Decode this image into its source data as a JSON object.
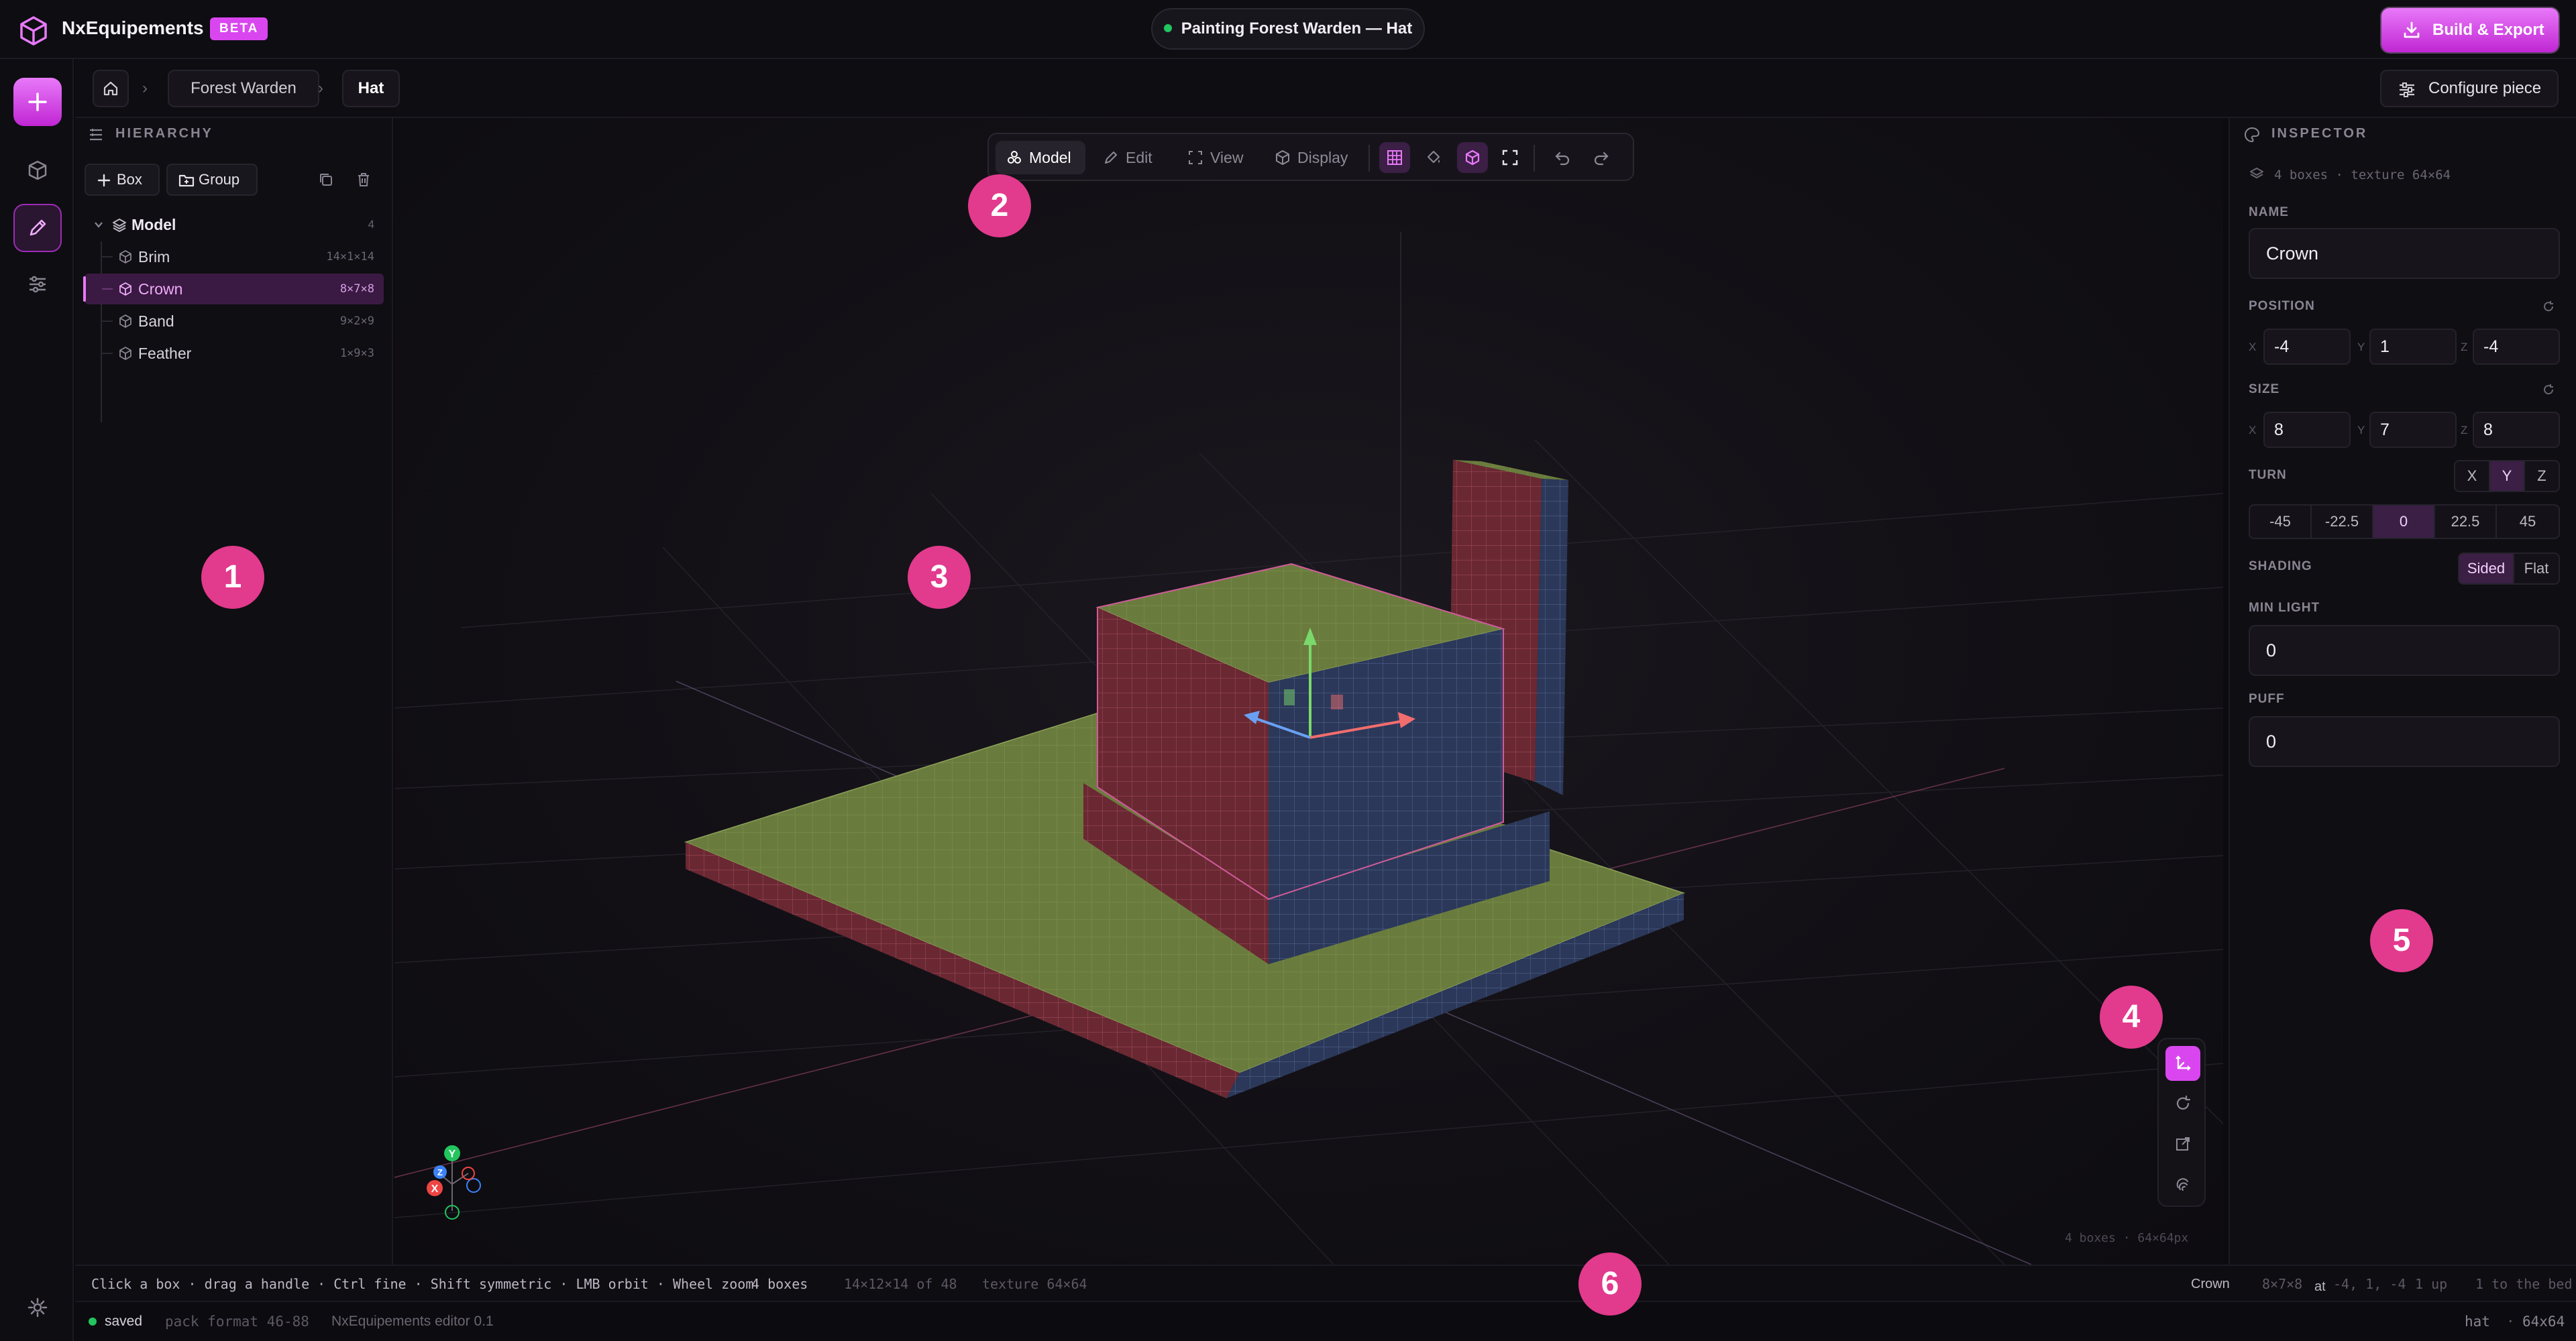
{
  "app": {
    "name": "NxEquipements",
    "badge": "BETA"
  },
  "status_pill": "Painting Forest Warden — Hat",
  "export_label": "Build & Export",
  "breadcrumb": {
    "items": [
      "Forest Warden",
      "Hat"
    ],
    "separator": "›"
  },
  "configure_label": "Configure piece",
  "hierarchy": {
    "title": "HIERARCHY",
    "add_box": "Box",
    "add_group": "Group",
    "root": {
      "label": "Model",
      "count": "4"
    },
    "items": [
      {
        "label": "Brim",
        "size": "14×1×14",
        "selected": false
      },
      {
        "label": "Crown",
        "size": "8×7×8",
        "selected": true
      },
      {
        "label": "Band",
        "size": "9×2×9",
        "selected": false
      },
      {
        "label": "Feather",
        "size": "1×9×3",
        "selected": false
      }
    ]
  },
  "viewport": {
    "tabs": [
      {
        "label": "Model",
        "active": true
      },
      {
        "label": "Edit",
        "active": false
      },
      {
        "label": "View",
        "active": false
      },
      {
        "label": "Display",
        "active": false
      }
    ],
    "corner_stat": "4 boxes · 64×64px",
    "gizmo_axes": [
      "Y",
      "X",
      "Z"
    ]
  },
  "inspector": {
    "title": "INSPECTOR",
    "subtitle": "4 boxes · texture 64×64",
    "name_label": "NAME",
    "name_value": "Crown",
    "position_label": "POSITION",
    "position": {
      "x": "-4",
      "y": "1",
      "z": "-4"
    },
    "size_label": "SIZE",
    "size": {
      "x": "8",
      "y": "7",
      "z": "8"
    },
    "axis_labels": {
      "x": "X",
      "y": "Y",
      "z": "Z"
    },
    "turn_label": "TURN",
    "turn_axes": [
      "X",
      "Y",
      "Z"
    ],
    "turn_axis_selected": "Y",
    "turn_values": [
      "-45",
      "-22.5",
      "0",
      "22.5",
      "45"
    ],
    "turn_selected": "0",
    "shading_label": "SHADING",
    "shading_options": [
      "Sided",
      "Flat"
    ],
    "shading_selected": "Sided",
    "min_light_label": "MIN LIGHT",
    "min_light_value": "0",
    "puff_label": "PUFF",
    "puff_value": "0"
  },
  "hint_bar": {
    "hints": "Click a box · drag a handle · Ctrl fine · Shift symmetric · LMB orbit · Wheel zoom",
    "boxes": "4 boxes",
    "area": "14×12×14 of 48",
    "texture": "texture 64×64",
    "sel_name": "Crown",
    "sel_size": "8×7×8",
    "sel_at_word": "at",
    "sel_pos": "-4, 1, -4",
    "sel_up": "1 up",
    "sel_bed": "1 to the bed"
  },
  "status_bar": {
    "saved": "saved",
    "format": "pack format 46-88",
    "version": "NxEquipements editor 0.1",
    "piece": "hat",
    "texture": "64x64"
  },
  "markers": [
    "1",
    "2",
    "3",
    "4",
    "5",
    "6"
  ],
  "colors": {
    "accent": "#d946ef",
    "marker": "#e23a8d",
    "saved": "#22c55e",
    "top_face": "#6b7d3f",
    "side_red": "#6e2a34",
    "side_blue": "#2d3a5e"
  }
}
